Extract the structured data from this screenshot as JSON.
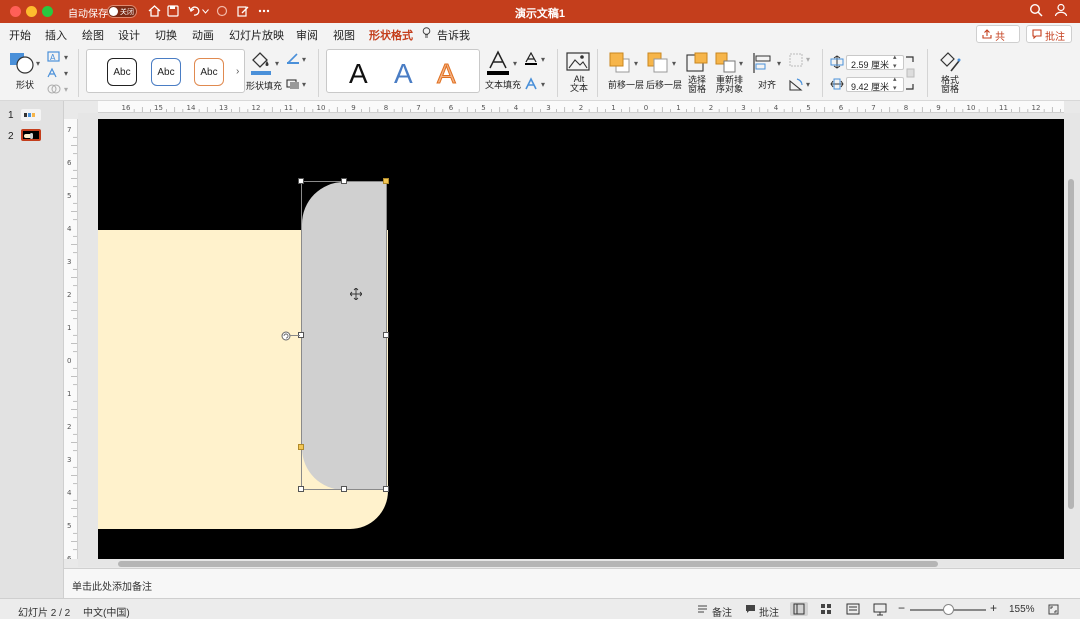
{
  "titlebar": {
    "autosave_label": "自动保存",
    "autosave_state": "关闭",
    "doc_title": "演示文稿1"
  },
  "tabs": [
    {
      "label": "开始"
    },
    {
      "label": "插入"
    },
    {
      "label": "绘图"
    },
    {
      "label": "设计"
    },
    {
      "label": "切换"
    },
    {
      "label": "动画"
    },
    {
      "label": "幻灯片放映"
    },
    {
      "label": "审阅"
    },
    {
      "label": "视图"
    },
    {
      "label": "形状格式",
      "active": true
    },
    {
      "label": "告诉我"
    }
  ],
  "actions": {
    "share": "共享",
    "comment": "批注"
  },
  "ribbon": {
    "shape_label": "形状",
    "style_samples": [
      "Abc",
      "Abc",
      "Abc"
    ],
    "shape_fill_label": "形状填充",
    "wordart_samples": [
      "A",
      "A",
      "A"
    ],
    "text_fill_label": "文本填充",
    "alt_text_label": "Alt\n文本",
    "bring_forward_label": "前移一层",
    "send_backward_label": "后移一层",
    "selection_pane_label": "选择\n窗格",
    "reorder_label": "重新排\n序对象",
    "align_label": "对齐",
    "height_value": "2.59 厘米",
    "width_value": "9.42 厘米",
    "format_pane_label": "格式\n窗格"
  },
  "slides_panel": {
    "items": [
      {
        "num": "1"
      },
      {
        "num": "2",
        "selected": true
      }
    ]
  },
  "ruler": {
    "h_ticks": [
      "16",
      "15",
      "14",
      "13",
      "12",
      "11",
      "10",
      "9",
      "8",
      "7",
      "6",
      "5",
      "4",
      "3",
      "2",
      "1",
      "0",
      "1",
      "2",
      "3",
      "4",
      "5",
      "6",
      "7",
      "8",
      "9",
      "10",
      "11",
      "12"
    ],
    "v_ticks": [
      "7",
      "6",
      "5",
      "4",
      "3",
      "2",
      "1",
      "0",
      "1",
      "2",
      "3",
      "4",
      "5",
      "6"
    ]
  },
  "notes": {
    "placeholder": "单击此处添加备注"
  },
  "status": {
    "slide_info": "幻灯片 2 / 2",
    "language": "中文(中国)",
    "notes_label": "备注",
    "comments_label": "批注",
    "zoom": "155%",
    "zoom_fraction": 0.5
  },
  "colors": {
    "accent": "#c43e1c",
    "slide_bg": "#000000",
    "cream": "#fff2cc",
    "grey_shape": "#d0d0d0"
  }
}
